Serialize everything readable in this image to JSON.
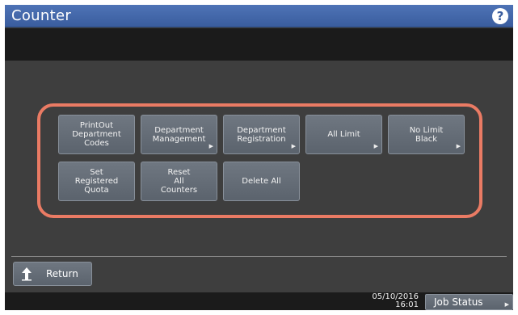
{
  "window": {
    "title": "Counter",
    "help_icon": "?"
  },
  "functions": [
    {
      "label": "PrintOut\nDepartment\nCodes",
      "has_submenu": false
    },
    {
      "label": "Department\nManagement",
      "has_submenu": true
    },
    {
      "label": "Department\nRegistration",
      "has_submenu": true
    },
    {
      "label": "All Limit",
      "has_submenu": true
    },
    {
      "label": "No Limit\nBlack",
      "has_submenu": true
    },
    {
      "label": "Set\nRegistered\nQuota",
      "has_submenu": false
    },
    {
      "label": "Reset\nAll\nCounters",
      "has_submenu": false
    },
    {
      "label": "Delete All",
      "has_submenu": false
    }
  ],
  "highlight_color": "#ea7b64",
  "return_button": {
    "label": "Return",
    "icon": "return-arrow-icon"
  },
  "footer": {
    "date": "05/10/2016",
    "time": "16:01",
    "job_status_label": "Job Status"
  },
  "submenu_marker": "▶"
}
